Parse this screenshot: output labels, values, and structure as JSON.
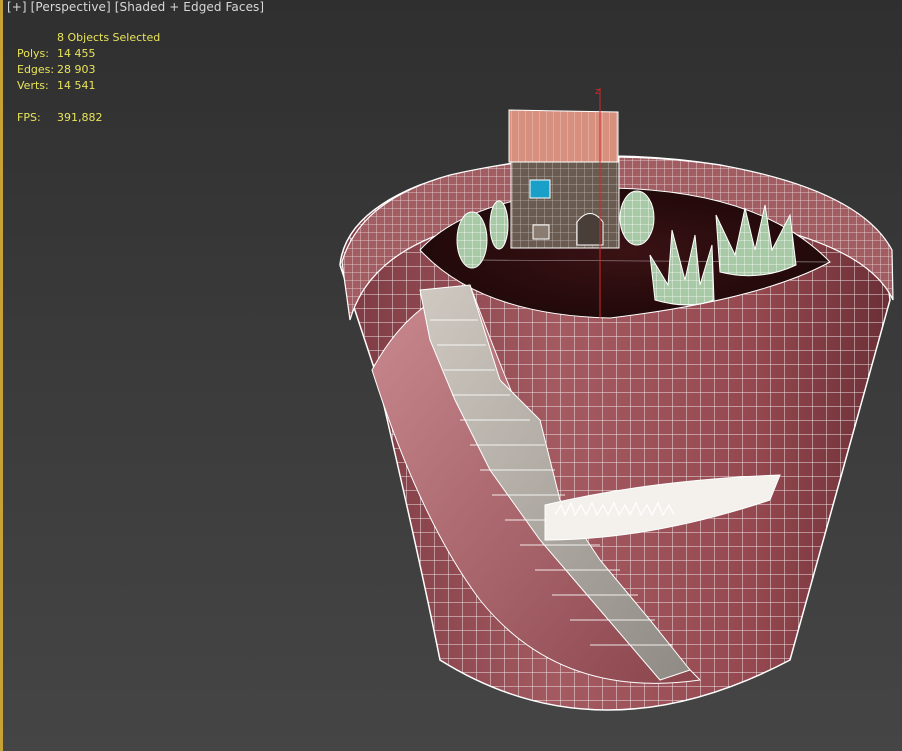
{
  "viewport": {
    "menu_plus": "[+]",
    "menu_view": "[Perspective]",
    "menu_shading": "[Shaded + Edged Faces]"
  },
  "stats": {
    "selected": "8 Objects Selected",
    "polys_label": "Polys:",
    "polys_value": "14 455",
    "edges_label": "Edges:",
    "edges_value": "28 903",
    "verts_label": "Verts:",
    "verts_value": "14 541",
    "fps_label": "FPS:",
    "fps_value": "391,882"
  },
  "colors": {
    "stats_text": "#e8e45a",
    "active_border": "#c8a235",
    "wire": "#ffffff",
    "brick": "#9a5258",
    "soil": "#2a0c0e",
    "stairs": "#b9b2aa",
    "plant": "#9fc39f",
    "roof": "#d8907e",
    "house_wall": "#6a5b50",
    "window": "#1aa0c8"
  },
  "icons": {
    "pivot_axis": "gizmo-z-axis-icon"
  }
}
